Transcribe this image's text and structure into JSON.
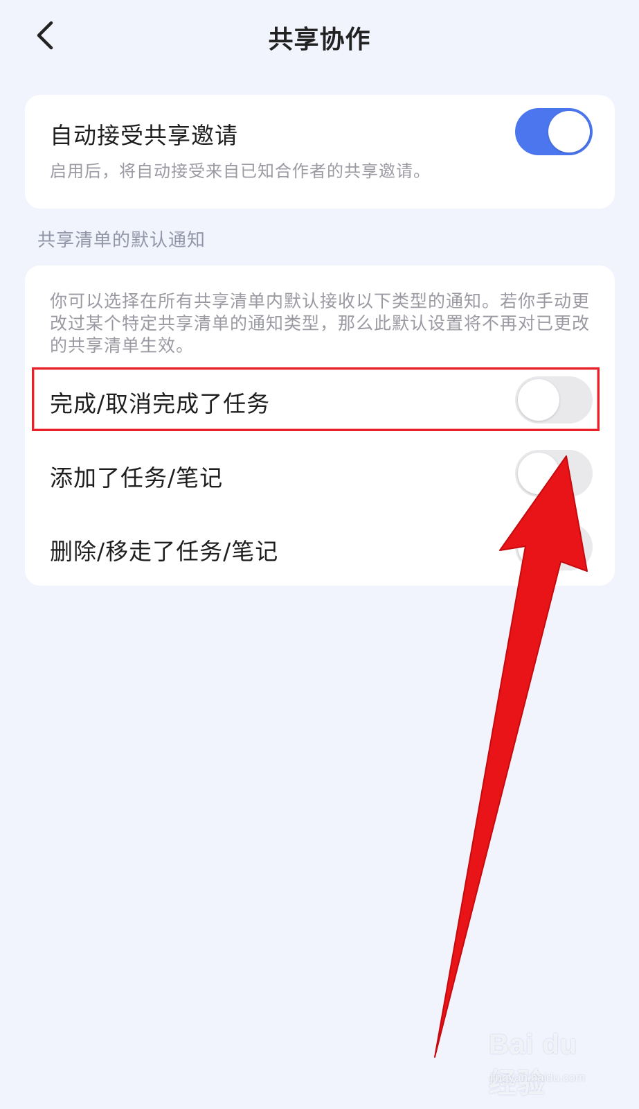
{
  "header": {
    "title": "共享协作",
    "back_icon": "chevron-left-icon"
  },
  "auto_accept": {
    "title": "自动接受共享邀请",
    "description": "启用后，将自动接受来自已知合作者的共享邀请。",
    "enabled": true
  },
  "section_label": "共享清单的默认通知",
  "notifications": {
    "description": "你可以选择在所有共享清单内默认接收以下类型的通知。若你手动更改过某个特定共享清单的通知类型，那么此默认设置将不再对已更改的共享清单生效。",
    "items": [
      {
        "label": "完成/取消完成了任务",
        "enabled": false
      },
      {
        "label": "添加了任务/笔记",
        "enabled": false
      },
      {
        "label": "删除/移走了任务/笔记",
        "enabled": false
      }
    ]
  },
  "colors": {
    "background": "#f1f3fd",
    "toggle_on": "#4b76ee",
    "toggle_off": "#e9e9ec",
    "annotation": "#e8202a"
  },
  "watermark": {
    "logo": "Bai du 经验",
    "site": "jingyan.baidu.com"
  }
}
